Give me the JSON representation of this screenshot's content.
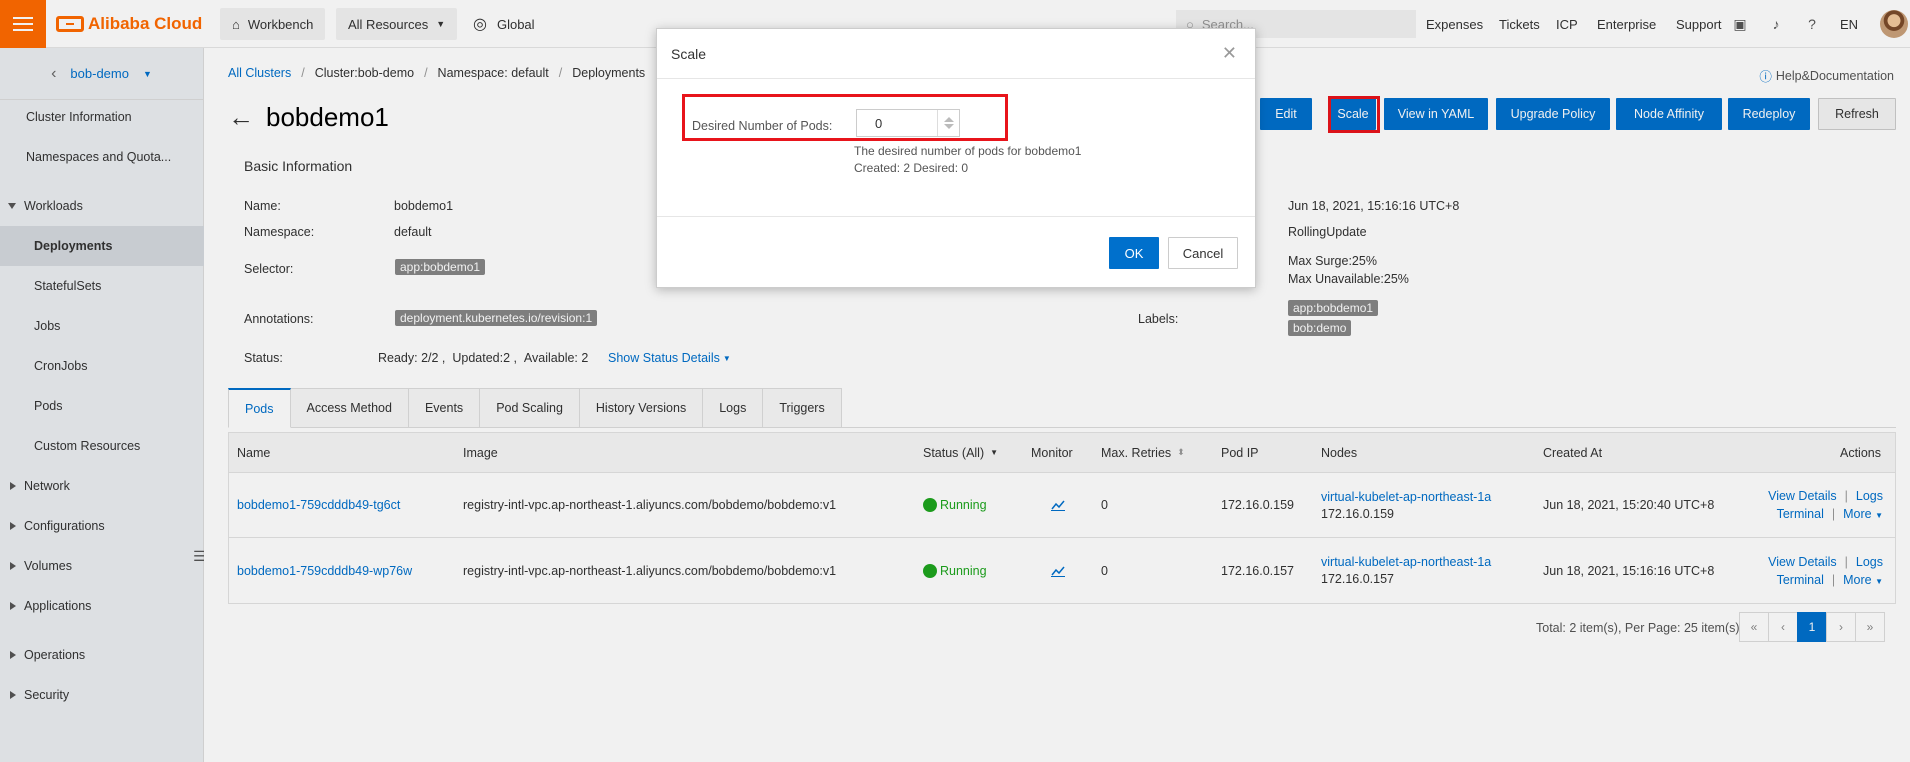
{
  "topbar": {
    "brand": "Alibaba Cloud",
    "workbench": "Workbench",
    "all_resources": "All Resources",
    "region": "Global",
    "search_placeholder": "Search...",
    "links": [
      "Expenses",
      "Tickets",
      "ICP",
      "Enterprise",
      "Support"
    ],
    "language": "EN"
  },
  "sidebar": {
    "cluster": "bob-demo",
    "items": [
      {
        "label": "Cluster Information"
      },
      {
        "label": "Namespaces and Quota..."
      },
      {
        "label": "Workloads"
      },
      {
        "label": "Deployments"
      },
      {
        "label": "StatefulSets"
      },
      {
        "label": "Jobs"
      },
      {
        "label": "CronJobs"
      },
      {
        "label": "Pods"
      },
      {
        "label": "Custom Resources"
      },
      {
        "label": "Network"
      },
      {
        "label": "Configurations"
      },
      {
        "label": "Volumes"
      },
      {
        "label": "Applications"
      },
      {
        "label": "Operations"
      },
      {
        "label": "Security"
      }
    ]
  },
  "breadcrumb": [
    "All Clusters",
    "Cluster:bob-demo",
    "Namespace: default",
    "Deployments"
  ],
  "help_doc": "Help&Documentation",
  "page_title": "bobdemo1",
  "actions": [
    "Edit",
    "Scale",
    "View in YAML",
    "Upgrade Policy",
    "Node Affinity",
    "Redeploy",
    "Refresh"
  ],
  "basic_info": {
    "title": "Basic Information",
    "name_label": "Name:",
    "name": "bobdemo1",
    "namespace_label": "Namespace:",
    "namespace": "default",
    "selector_label": "Selector:",
    "selector": "app:bobdemo1",
    "annotations_label": "Annotations:",
    "annotation": "deployment.kubernetes.io/revision:1",
    "status_label": "Status:",
    "status": "Ready: 2/2 ,  Updated:2 ,  Available: 2",
    "show_status": "Show Status Details",
    "created": "Jun 18, 2021, 15:16:16 UTC+8",
    "strategy": "RollingUpdate",
    "max_surge": "Max Surge:25%",
    "max_unavailable": "Max Unavailable:25%",
    "labels_label": "Labels:",
    "labels": [
      "app:bobdemo1",
      "bob:demo"
    ]
  },
  "tabs": [
    "Pods",
    "Access Method",
    "Events",
    "Pod Scaling",
    "History Versions",
    "Logs",
    "Triggers"
  ],
  "table": {
    "headers": [
      "Name",
      "Image",
      "Status (All)",
      "Monitor",
      "Max. Retries",
      "Pod IP",
      "Nodes",
      "Created At",
      "Actions"
    ],
    "rows": [
      {
        "name": "bobdemo1-759cdddb49-tg6ct",
        "image": "registry-intl-vpc.ap-northeast-1.aliyuncs.com/bobdemo/bobdemo:v1",
        "status": "Running",
        "retries": "0",
        "pod_ip": "172.16.0.159",
        "node": "virtual-kubelet-ap-northeast-1a",
        "node_ip": "172.16.0.159",
        "created": "Jun 18, 2021, 15:20:40 UTC+8"
      },
      {
        "name": "bobdemo1-759cdddb49-wp76w",
        "image": "registry-intl-vpc.ap-northeast-1.aliyuncs.com/bobdemo/bobdemo:v1",
        "status": "Running",
        "retries": "0",
        "pod_ip": "172.16.0.157",
        "node": "virtual-kubelet-ap-northeast-1a",
        "node_ip": "172.16.0.157",
        "created": "Jun 18, 2021, 15:16:16 UTC+8"
      }
    ],
    "row_actions": {
      "details": "View Details",
      "logs": "Logs",
      "terminal": "Terminal",
      "more": "More"
    }
  },
  "pagination": {
    "summary": "Total: 2 item(s), Per Page: 25 item(s)",
    "first": "«",
    "prev": "‹",
    "current": "1",
    "next": "›",
    "last": "»"
  },
  "modal": {
    "title": "Scale",
    "field_label": "Desired Number of Pods:",
    "value": "0",
    "help": "The desired number of pods for bobdemo1",
    "counts": "Created: 2 Desired: 0",
    "ok": "OK",
    "cancel": "Cancel"
  },
  "colors": {
    "brand": "#ff6a00",
    "primary": "#0070cc",
    "highlight": "#e8141b",
    "running": "#1ea51e"
  }
}
